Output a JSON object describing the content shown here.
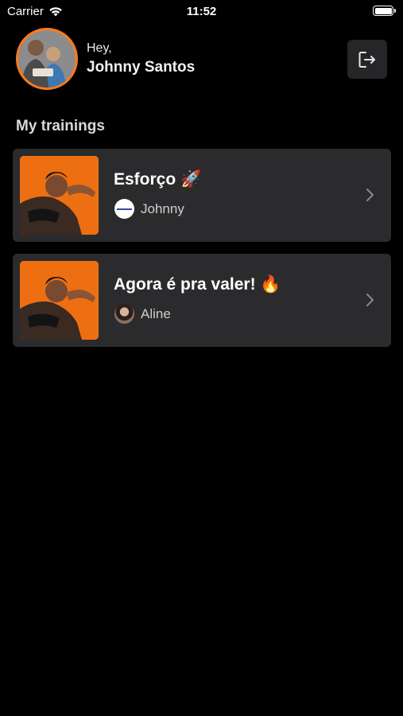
{
  "status_bar": {
    "carrier": "Carrier",
    "time": "11:52"
  },
  "header": {
    "greeting": "Hey,",
    "user_name": "Johnny Santos"
  },
  "section": {
    "title": "My trainings"
  },
  "trainings": [
    {
      "title": "Esforço 🚀",
      "owner": "Johnny"
    },
    {
      "title": "Agora é pra valer! 🔥",
      "owner": "Aline"
    }
  ],
  "colors": {
    "accent": "#ff7a1a",
    "card_bg": "#2b2b2d",
    "background": "#000000"
  },
  "icons": {
    "logout": "logout-icon",
    "chevron": "chevron-right-icon",
    "wifi": "wifi-icon",
    "battery": "battery-icon"
  }
}
